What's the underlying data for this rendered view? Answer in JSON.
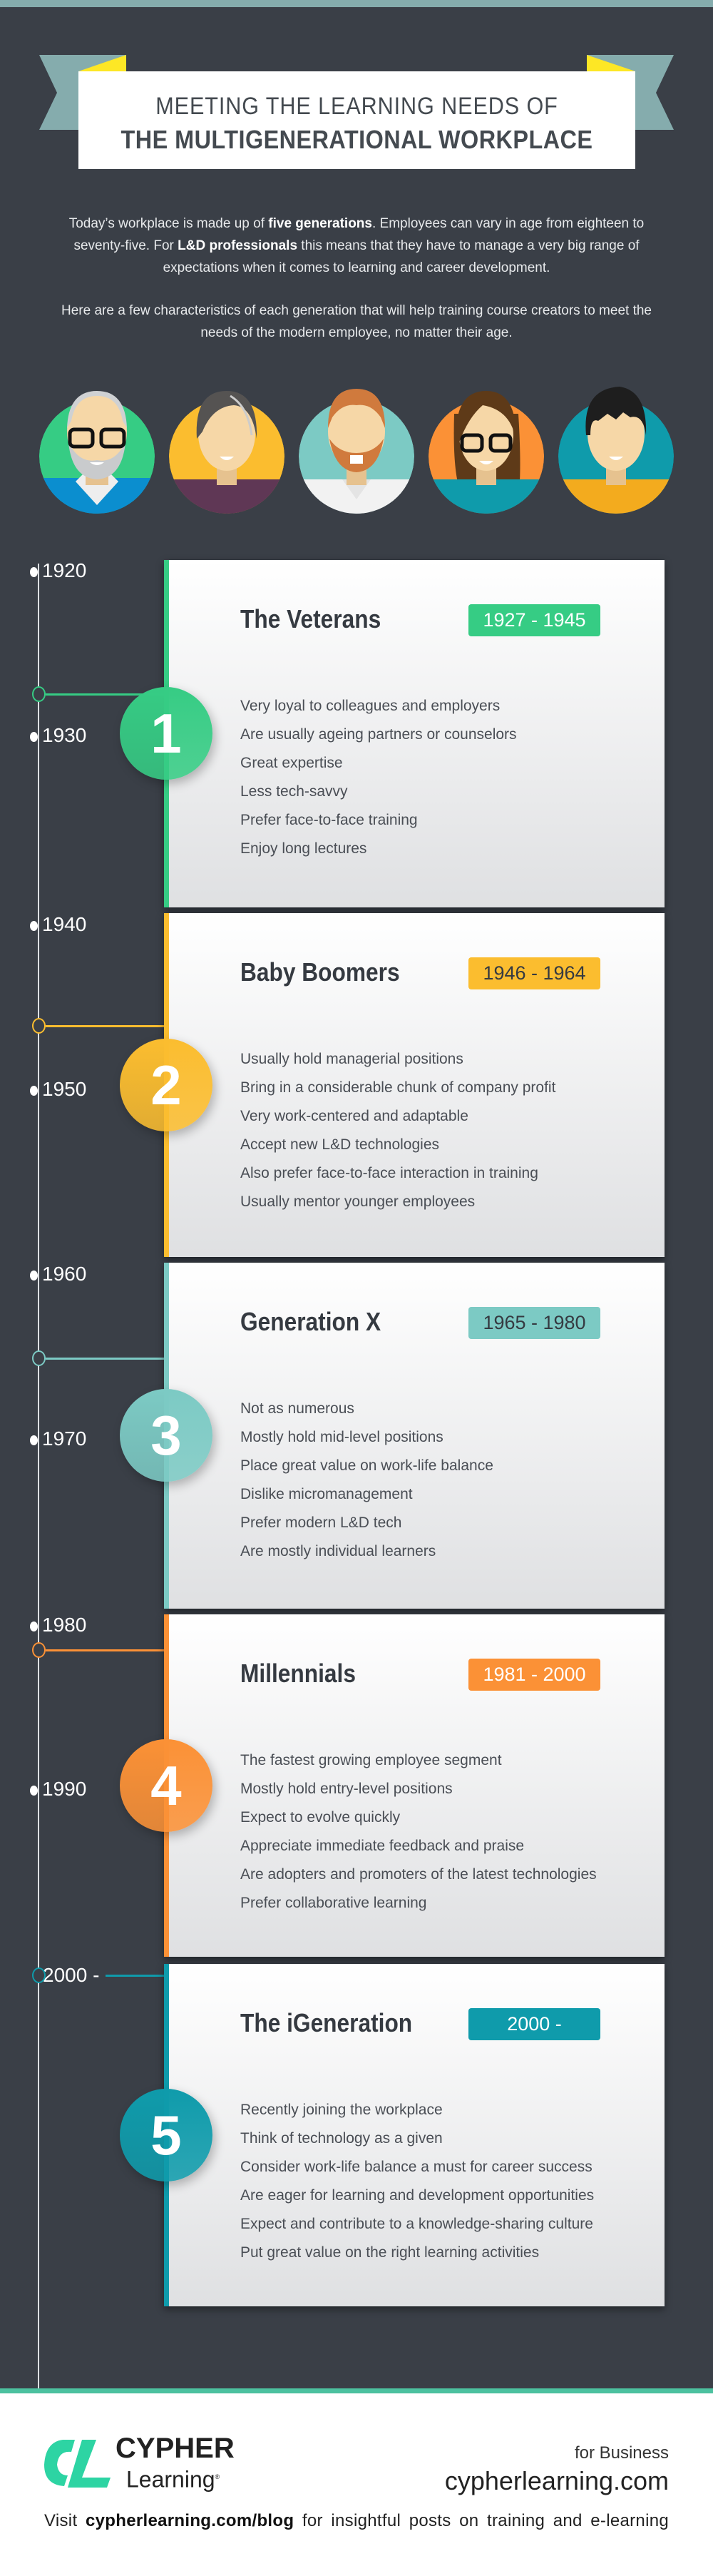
{
  "header": {
    "line1": "MEETING THE LEARNING NEEDS OF",
    "line2": "THE MULTIGENERATIONAL WORKPLACE"
  },
  "intro": {
    "p1_a": "Today’s workplace is made up of ",
    "p1_b": "five generations",
    "p1_c": ". Employees can vary in age from eighteen to seventy-five. For ",
    "p1_d": "L&D professionals",
    "p1_e": " this means that they have to manage a very big range of expectations when it comes to learning and career development.",
    "p2": "Here are a few characteristics of each generation that will help training course creators to meet the needs of the modern employee, no matter their age."
  },
  "avatars": [
    "veteran-avatar",
    "baby-boomer-avatar",
    "generation-x-avatar",
    "millennial-avatar",
    "igeneration-avatar"
  ],
  "colors": {
    "background": "#3a3f47",
    "green": "#36cc84",
    "yellow": "#fbbd2f",
    "teal": "#7ccac4",
    "orange": "#fb9136",
    "blue": "#0f9bab",
    "ribbon": "#85acad",
    "ribbon_fold": "#fde725"
  },
  "years": [
    "1920",
    "1930",
    "1940",
    "1950",
    "1960",
    "1970",
    "1980",
    "1990",
    "2000 -"
  ],
  "generations": [
    {
      "number": "1",
      "name": "The Veterans",
      "range": "1927 - 1945",
      "traits": [
        "Very loyal to colleagues and employers",
        "Are usually ageing partners or counselors",
        "Great expertise",
        "Less tech-savvy",
        "Prefer face-to-face training",
        "Enjoy long lectures"
      ]
    },
    {
      "number": "2",
      "name": "Baby Boomers",
      "range": "1946 - 1964",
      "traits": [
        "Usually hold managerial positions",
        "Bring in a considerable chunk of company profit",
        "Very work-centered and adaptable",
        "Accept new L&D technologies",
        "Also prefer face-to-face interaction in training",
        "Usually mentor younger employees"
      ]
    },
    {
      "number": "3",
      "name": "Generation X",
      "range": "1965 - 1980",
      "traits": [
        "Not as numerous",
        "Mostly hold mid-level positions",
        "Place great value on work-life balance",
        "Dislike micromanagement",
        "Prefer modern L&D tech",
        "Are mostly individual learners"
      ]
    },
    {
      "number": "4",
      "name": "Millennials",
      "range": "1981 - 2000",
      "traits": [
        "The fastest growing employee segment",
        "Mostly hold entry-level positions",
        "Expect to evolve quickly",
        "Appreciate immediate feedback and praise",
        "Are adopters and promoters of the latest technologies",
        "Prefer collaborative learning"
      ]
    },
    {
      "number": "5",
      "name": "The iGeneration",
      "range": "2000 -",
      "traits": [
        "Recently joining the workplace",
        "Think of technology as a given",
        "Consider work-life balance a must for career success",
        "Are eager for learning and development opportunities",
        "Expect and contribute to a knowledge-sharing culture",
        "Put great value on the right learning activities"
      ]
    }
  ],
  "footer": {
    "brand_top": "CYPHER",
    "brand_bottom": "Learning",
    "registered": "®",
    "for_business": "for Business",
    "site": "cypherlearning.com",
    "visit_a": "Visit ",
    "visit_link": "cypherlearning.com/blog",
    "visit_b": " for insightful posts on training and e-learning"
  }
}
